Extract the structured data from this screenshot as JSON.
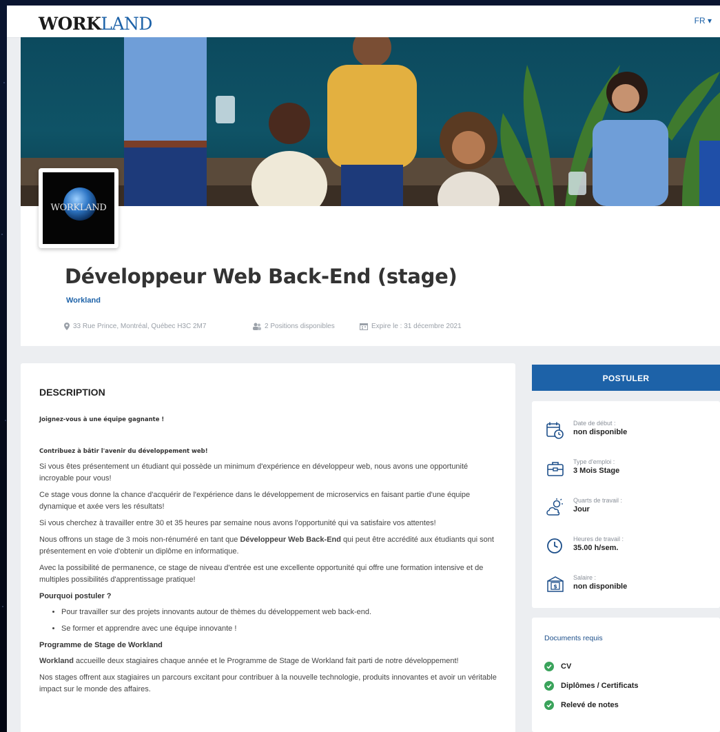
{
  "header": {
    "logo_part1": "WORK",
    "logo_part2": "LAND",
    "language": "FR ▾"
  },
  "company_logo_text": "WORKLAND",
  "job": {
    "title": "Développeur Web Back-End (stage)",
    "company": "Workland",
    "address": "33 Rue Prince, Montréal, Québec H3C 2M7",
    "positions": "2 Positions disponibles",
    "expiry": "Expire le : 31 décembre 2021"
  },
  "description": {
    "heading": "DESCRIPTION",
    "tagline1": "Joignez-vous à une équipe gagnante !",
    "tagline2": "Contribuez à bâtir l'avenir du développement web!",
    "p1": "Si vous êtes présentement un étudiant qui possède un minimum d'expérience en développeur web, nous avons une opportunité incroyable pour vous!",
    "p2": "Ce stage vous donne la chance d'acquérir de l'expérience dans  le développement de microservics en faisant partie d'une équipe dynamique et axée vers les résultats!",
    "p3": "Si vous cherchez à travailler entre 30 et 35 heures par semaine nous avons l'opportunité qui va satisfaire vos attentes!",
    "p4_before": "Nous offrons un stage de 3 mois non-rénuméré en tant que ",
    "p4_bold": "Développeur Web Back-End",
    "p4_after": "  qui peut être accrédité aux étudiants qui sont présentement en voie d'obtenir un diplôme en informatique.",
    "p5": "Avec la possibilité de permanence, ce stage de niveau d'entrée est une excellente opportunité qui offre une formation intensive et de multiples possibilités d'apprentissage pratique!",
    "why_heading": "Pourquoi postuler ?",
    "bullets": [
      "Pour travailler sur des projets innovants autour de thèmes du développement web back-end.",
      "Se former et apprendre avec une équipe innovante !"
    ],
    "program_heading": "Programme de Stage de Workland",
    "p6_bold": "Workland",
    "p6_after": " accueille deux stagiaires chaque année et le Programme de Stage de Workland fait parti de notre développement!",
    "p7": "Nos stages offrent aux stagiaires un parcours excitant pour contribuer à la nouvelle technologie, produits innovantes et avoir un véritable impact sur le monde des affaires."
  },
  "apply_label": "POSTULER",
  "info": [
    {
      "label": "Date de début :",
      "value": "non disponible",
      "icon": "calendar-clock-icon"
    },
    {
      "label": "Type d'emploi :",
      "value": "3 Mois Stage",
      "icon": "briefcase-icon"
    },
    {
      "label": "Quarts de travail :",
      "value": "Jour",
      "icon": "sun-cloud-icon"
    },
    {
      "label": "Heures de travail :",
      "value": "35.00 h/sem.",
      "icon": "clock-icon"
    },
    {
      "label": "Salaire :",
      "value": "non disponible",
      "icon": "money-icon"
    }
  ],
  "documents": {
    "title": "Documents requis",
    "items": [
      "CV",
      "Diplômes / Certificats",
      "Relevé de notes"
    ]
  },
  "colors": {
    "brand_blue": "#1d62a8",
    "check_green": "#3aa35b",
    "background": "#eceef1"
  }
}
